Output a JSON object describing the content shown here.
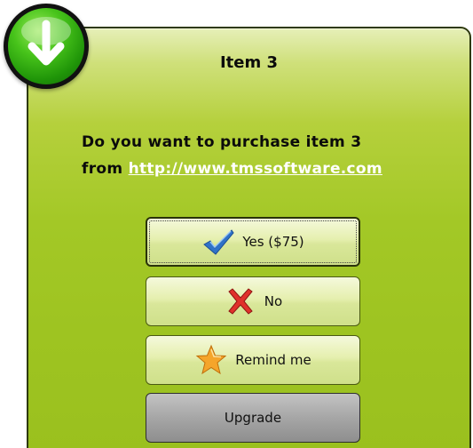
{
  "dialog": {
    "title": "Item 3",
    "message_line1": "Do you want to purchase item 3",
    "message_from": "from ",
    "link_text": "http://www.tmssoftware.com"
  },
  "buttons": {
    "yes_label": "Yes ($75)",
    "no_label": "No",
    "remind_label": "Remind me",
    "upgrade_label": "Upgrade"
  },
  "icons": {
    "badge": "download-arrow-icon",
    "yes": "checkmark-icon",
    "no": "red-x-icon",
    "remind": "star-icon"
  },
  "colors": {
    "panel_green": "#9ec421",
    "badge_green": "#48c41b",
    "link": "#ffffff"
  }
}
